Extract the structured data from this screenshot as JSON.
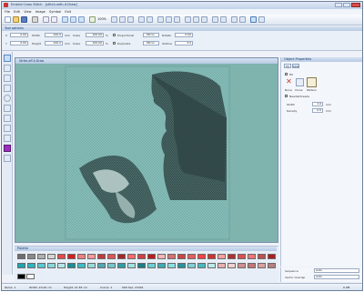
{
  "window": {
    "title": "Embird Cross Stitch - [stitch-with-it.Draw]"
  },
  "menu": [
    "File",
    "Edit",
    "View",
    "Image",
    "Symbol",
    "Exit"
  ],
  "toolbar": {
    "zoom": "100%",
    "icons": [
      "new-icon",
      "open-icon",
      "save-icon",
      "print-icon",
      "undo-icon",
      "redo-icon",
      "zoom-icon",
      "grid-icon",
      "draw-icon"
    ]
  },
  "tool_options": {
    "title": "Tool options",
    "rows": [
      {
        "a": "0.00",
        "b": "Width",
        "c": "100.0",
        "d": "mm",
        "e": "Scale",
        "f": "100.00",
        "g": "%",
        "h": "Proportional",
        "i": "Mirror",
        "j": "Rotate",
        "k": "0.00"
      },
      {
        "a": "0.00",
        "b": "Height",
        "c": "100.0",
        "d": "mm",
        "e": "Scale",
        "f": "100.00",
        "g": "%",
        "h": "Duplicate",
        "i": "Mirror",
        "j": "Outline",
        "k": "3.0"
      }
    ]
  },
  "document": {
    "title": "Strike-off-it.Draw"
  },
  "right_panel": {
    "title": "Object Properties",
    "tabs": [
      "Fill",
      "Line"
    ],
    "fill_label": "Fill",
    "buttons": [
      "None",
      "Clone",
      "Pattern"
    ],
    "checkbox": "Needlethreads",
    "width_label": "Width",
    "width_value": "1.0",
    "width_unit": "mm",
    "density_label": "Density",
    "density_value": "0.5",
    "density_unit": "mm",
    "sequence_label": "Sequence",
    "sequence_value": "Auto",
    "tracing_label": "Vector Overlap",
    "tracing_value": "Auto"
  },
  "palette": {
    "title": "Palette",
    "colors": [
      "#6d6d6d",
      "#8a8a8a",
      "#b0b0b0",
      "#d5d5d5",
      "#e44a4a",
      "#d02020",
      "#f08080",
      "#ff9a9a",
      "#c23b3b",
      "#e05555",
      "#a02828",
      "#ff6b6b",
      "#d04040",
      "#b91d1d",
      "#f5b5b5",
      "#d97070",
      "#c44",
      "#e65c5c",
      "#ff4040",
      "#cc3333",
      "#ffa0a0",
      "#b03030",
      "#dd5050",
      "#ee7777",
      "#c05050",
      "#aa2020",
      "#1fa3b0",
      "#2bb5c2",
      "#58c9d3",
      "#86d7de",
      "#b3e6ea",
      "#1a8f9a",
      "#3cbdc8",
      "#9bd8dd",
      "#50a8b0",
      "#74c6cc",
      "#2d9ea8",
      "#a2e0e5",
      "#1b7f89",
      "#6acfd8",
      "#3faab4",
      "#8bdde3",
      "#25949e",
      "#7ecfd6",
      "#48b9c3",
      "#bde9ed",
      "#e8b0b0",
      "#f0d0d0",
      "#d09090",
      "#c47777",
      "#d8a0a0",
      "#b78080"
    ],
    "selected": [
      "#000000",
      "#ffffff"
    ]
  },
  "status": {
    "items": [
      "Items: 1",
      "Width: 20.00 cm",
      "Height: 21.83 cm",
      "Colors: 1",
      "Stitches: 24391"
    ],
    "right": "0.0M"
  }
}
